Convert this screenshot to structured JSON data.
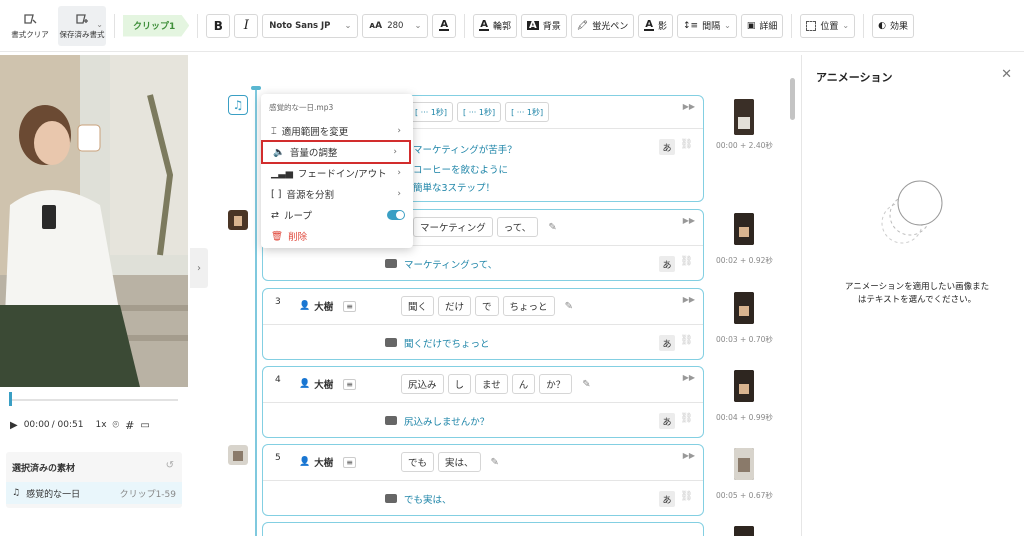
{
  "toolbar": {
    "clear_format": "書式クリア",
    "saved_format": "保存済み書式",
    "clip_tag": "クリップ1",
    "bold": "B",
    "italic": "I",
    "font": "Noto Sans JP",
    "font_size": "280",
    "outline": "輪郭",
    "background": "背景",
    "highlighter": "蛍光ペン",
    "shadow": "影",
    "spacing": "間隔",
    "details": "詳細",
    "position": "位置",
    "effects": "効果"
  },
  "player": {
    "current_time": "00:00",
    "total_time": "/ 00:51",
    "speed": "1x"
  },
  "selected_panel": {
    "title": "選択済みの素材",
    "item_name": "感覚的な一日",
    "item_clip": "クリップ1-59"
  },
  "context_menu": {
    "title": "感覚的な一日.mp3",
    "items": [
      {
        "label": "適用範囲を変更"
      },
      {
        "label": "音量の調整"
      },
      {
        "label": "フェードイン/アウト"
      },
      {
        "label": "音源を分割"
      },
      {
        "label": "ループ"
      },
      {
        "label": "削除"
      }
    ]
  },
  "blocks": [
    {
      "tokens": [
        "[ ··· 1秒]",
        "[ ··· 1秒]",
        "[ ··· 1秒]"
      ],
      "lines": [
        "マーケティングが苦手？",
        "コーヒーを飲むように",
        "簡単な3ステップ！"
      ],
      "ja": "あ",
      "time": "00:00 + 2.40秒"
    },
    {
      "tokens": [
        "マーケティング",
        "って、"
      ],
      "subtitle": "マーケティングって、",
      "ja": "あ",
      "time": "00:02 + 0.92秒"
    },
    {
      "num": "3",
      "speaker": "大樹",
      "tokens": [
        "聞く",
        "だけ",
        "で",
        "ちょっと"
      ],
      "subtitle": "聞くだけでちょっと",
      "ja": "あ",
      "time": "00:03 + 0.70秒"
    },
    {
      "num": "4",
      "speaker": "大樹",
      "tokens": [
        "尻込み",
        "し",
        "ませ",
        "ん",
        "か？"
      ],
      "subtitle": "尻込みしませんか？",
      "ja": "あ",
      "time": "00:04 + 0.99秒"
    },
    {
      "num": "5",
      "speaker": "大樹",
      "tokens": [
        "でも",
        "実は、"
      ],
      "subtitle": "でも実は、",
      "ja": "あ",
      "time": "00:05 + 0.67秒"
    }
  ],
  "right_panel": {
    "title": "アニメーション",
    "message": "アニメーションを適用したい画像またはテキストを選んでください。"
  },
  "colors": {
    "accent": "#3a9fc4",
    "block_border": "#83cfe2",
    "highlight_box": "#d22d2d",
    "clip_tag_bg": "#e4f5e0",
    "danger": "#e0473a"
  }
}
